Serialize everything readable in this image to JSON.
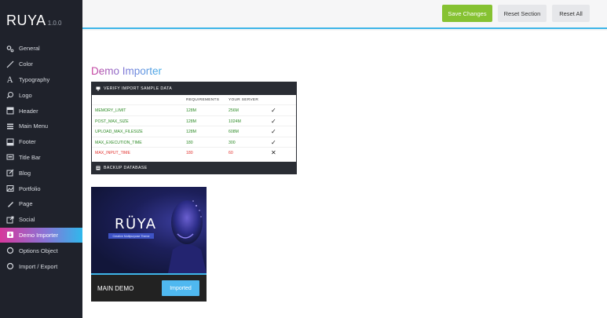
{
  "brand": {
    "name": "RUYA",
    "version": "1.0.0"
  },
  "sidebar": {
    "items": [
      {
        "label": "General",
        "icon": "gears-icon"
      },
      {
        "label": "Color",
        "icon": "pencil-icon"
      },
      {
        "label": "Typography",
        "icon": "font-icon"
      },
      {
        "label": "Logo",
        "icon": "leaf-icon"
      },
      {
        "label": "Header",
        "icon": "header-icon"
      },
      {
        "label": "Main Menu",
        "icon": "list-icon"
      },
      {
        "label": "Footer",
        "icon": "footer-icon"
      },
      {
        "label": "Title Bar",
        "icon": "titlebar-icon"
      },
      {
        "label": "Blog",
        "icon": "edit-icon"
      },
      {
        "label": "Portfolio",
        "icon": "image-icon"
      },
      {
        "label": "Page",
        "icon": "pen-icon"
      },
      {
        "label": "Social",
        "icon": "share-icon"
      },
      {
        "label": "Demo Importer",
        "icon": "download-icon",
        "active": true
      },
      {
        "label": "Options Object",
        "icon": "refresh-icon"
      },
      {
        "label": "Import / Export",
        "icon": "refresh-icon"
      }
    ]
  },
  "toolbar": {
    "save_label": "Save Changes",
    "reset_section_label": "Reset Section",
    "reset_all_label": "Reset All"
  },
  "page": {
    "title_part1": "Demo",
    "title_part2": "Importer"
  },
  "verify": {
    "header": "VERIFY IMPORT SAMPLE DATA",
    "col_requirements": "REQUIREMENTS",
    "col_server": "YOUR SERVER",
    "rows": [
      {
        "name": "MEMORY_LIMIT",
        "req": "128M",
        "server": "256M",
        "mark": "✓",
        "status": "ok"
      },
      {
        "name": "POST_MAX_SIZE",
        "req": "128M",
        "server": "1024M",
        "mark": "✓",
        "status": "ok"
      },
      {
        "name": "UPLOAD_MAX_FILESIZE",
        "req": "128M",
        "server": "608M",
        "mark": "✓",
        "status": "ok"
      },
      {
        "name": "MAX_EXECUTION_TIME",
        "req": "180",
        "server": "300",
        "mark": "✓",
        "status": "ok"
      },
      {
        "name": "MAX_INPUT_TIME",
        "req": "180",
        "server": "60",
        "mark": "✕",
        "status": "bad"
      }
    ],
    "footer": "BACKUP DATABASE"
  },
  "demo": {
    "logo": "RÜYA",
    "tagline": "Creative Multipurpose Theme",
    "label": "MAIN DEMO",
    "button_label": "Imported"
  },
  "colors": {
    "accent": "#3eb5e8",
    "save": "#86c232",
    "ok": "#2c8a25",
    "bad": "#e2322e",
    "sidebar_bg": "#1f222b"
  }
}
